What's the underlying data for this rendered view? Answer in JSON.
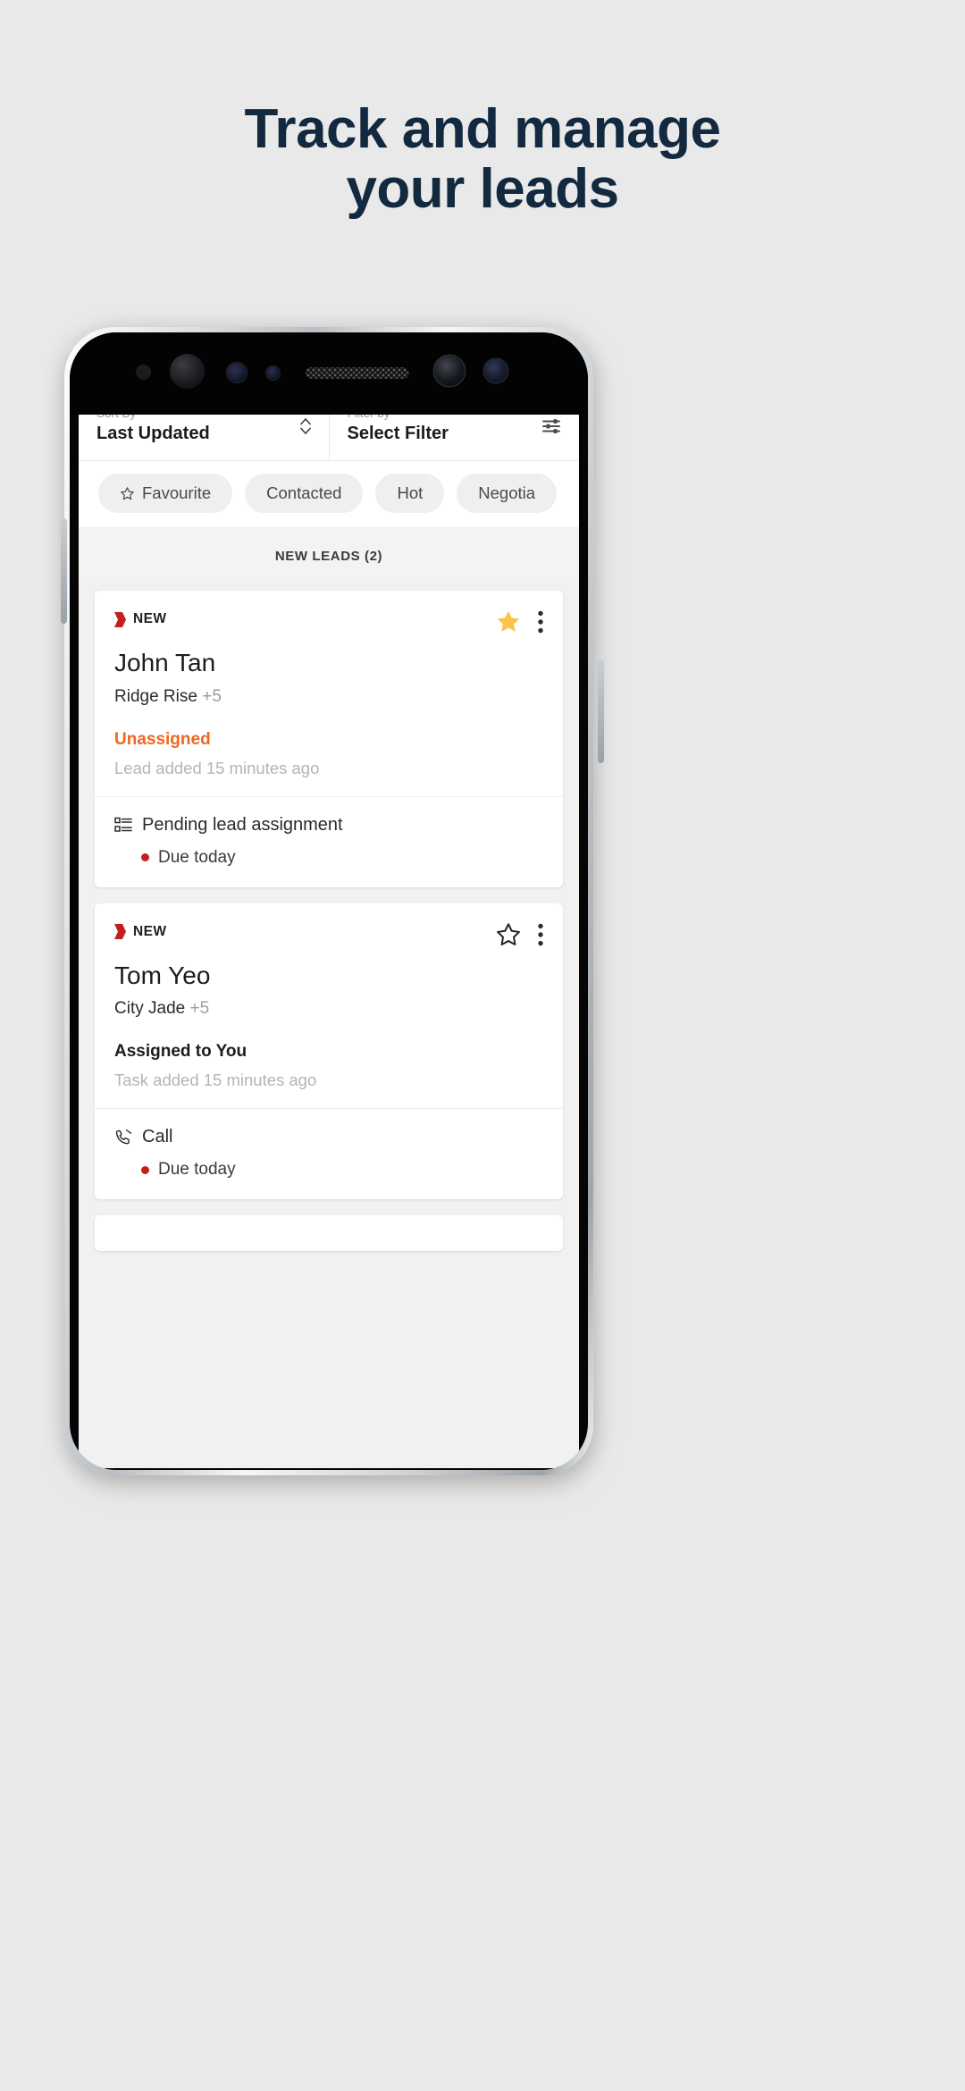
{
  "promo": {
    "headline_line1": "Track and manage",
    "headline_line2": "your leads",
    "headline_color": "#12293f",
    "background_color": "#e9e9e9"
  },
  "app": {
    "sort": {
      "label": "Sort By",
      "value": "Last Updated",
      "icon": "chevron-up-down-icon"
    },
    "filter": {
      "label": "Filter by",
      "value": "Select Filter",
      "icon": "sliders-icon"
    },
    "chips": [
      {
        "label": "Favourite",
        "icon": "star-outline-icon"
      },
      {
        "label": "Contacted",
        "icon": ""
      },
      {
        "label": "Hot",
        "icon": ""
      },
      {
        "label": "Negotia",
        "icon": ""
      }
    ],
    "section_header": "NEW LEADS (2)",
    "cards": [
      {
        "badge": "NEW",
        "badge_icon": "red-flag-icon",
        "favourite": true,
        "favourite_icon": "star-filled-icon",
        "menu_icon": "kebab-menu-icon",
        "name": "John Tan",
        "project": "Ridge Rise",
        "project_extra": "+5",
        "assignment": "Unassigned",
        "assignment_state": "unassigned",
        "added": "Lead added 15 minutes ago",
        "task_icon": "list-icon",
        "task": "Pending lead assignment",
        "due": "Due today"
      },
      {
        "badge": "NEW",
        "badge_icon": "red-flag-icon",
        "favourite": false,
        "favourite_icon": "star-outline-icon",
        "menu_icon": "kebab-menu-icon",
        "name": "Tom Yeo",
        "project": "City Jade",
        "project_extra": "+5",
        "assignment": "Assigned to You",
        "assignment_state": "assigned",
        "added": "Task added 15 minutes ago",
        "task_icon": "phone-icon",
        "task": "Call",
        "due": "Due today"
      }
    ],
    "colors": {
      "accent_red": "#c2201f",
      "accent_orange": "#f4661e",
      "star_gold": "#f9c44a"
    }
  }
}
